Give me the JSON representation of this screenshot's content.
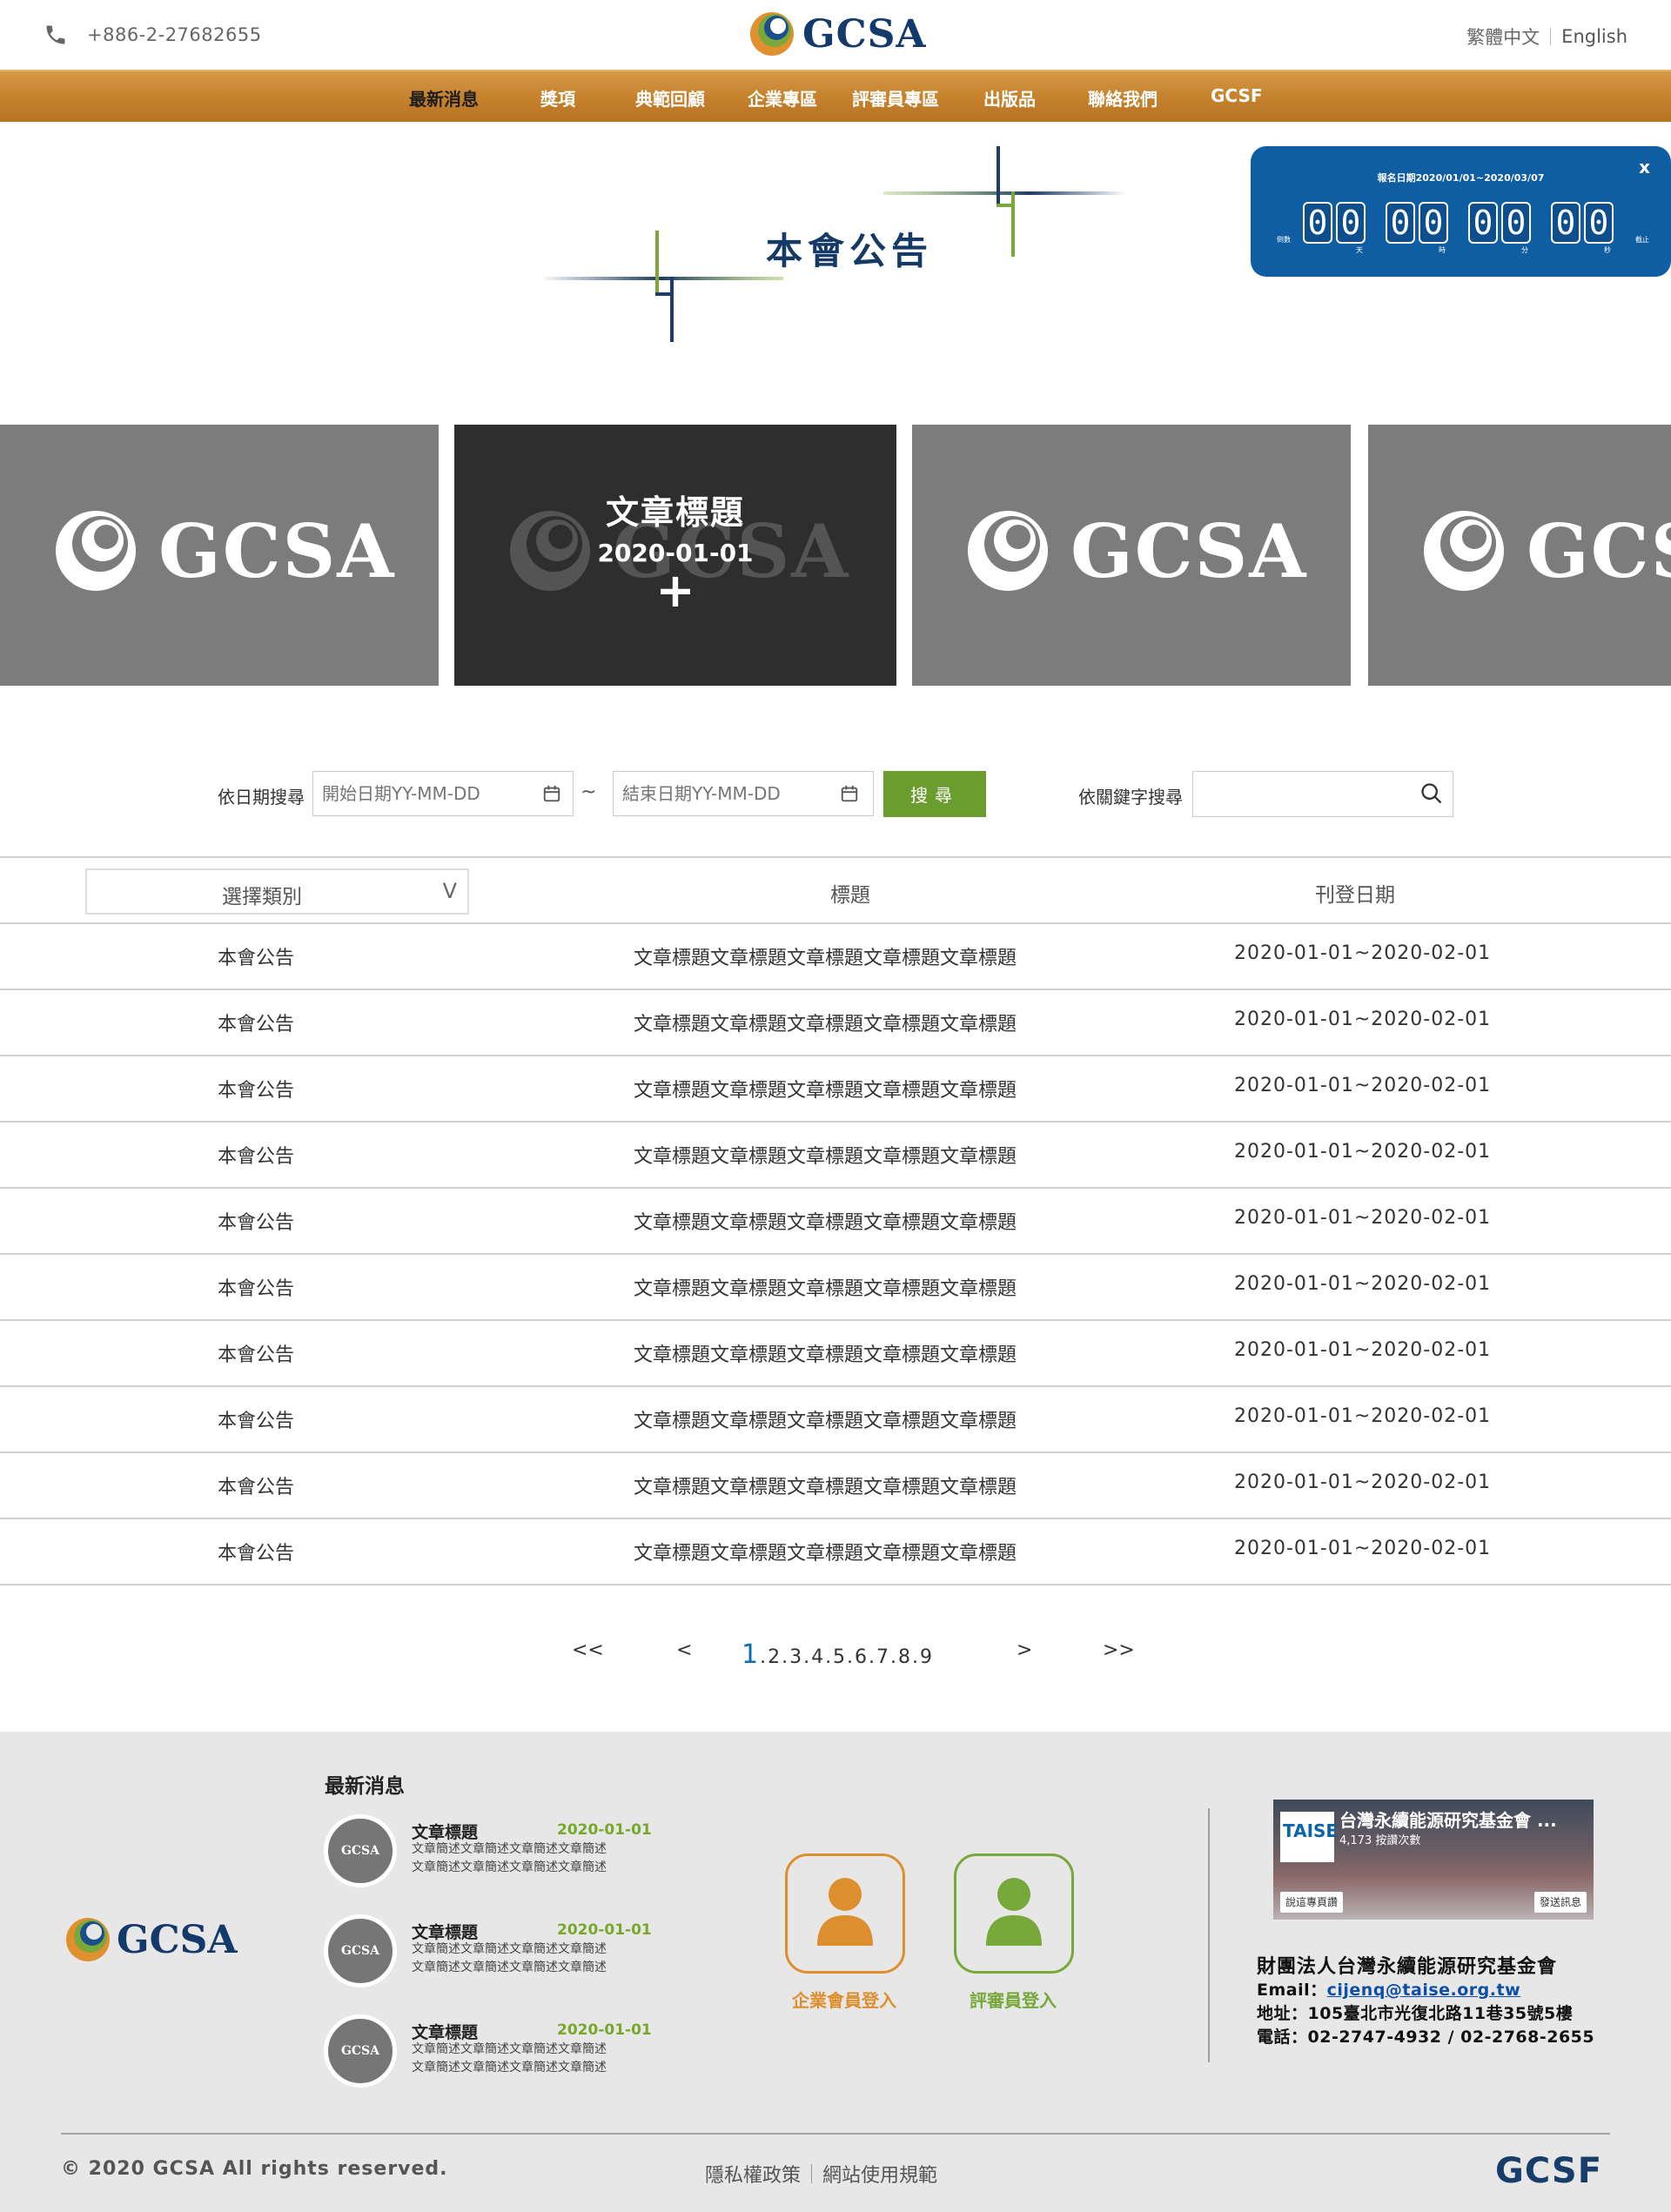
{
  "header": {
    "phone": "+886-2-27682655",
    "brand": "GCSA",
    "lang_zh": "繁體中文",
    "lang_en": "English"
  },
  "nav": {
    "items": [
      "最新消息",
      "獎項",
      "典範回顧",
      "企業專區",
      "評審員專區",
      "出版品",
      "聯絡我們",
      "GCSF"
    ]
  },
  "page_title": "本會公告",
  "countdown": {
    "close": "x",
    "period": "報名日期2020/01/01~2020/03/07",
    "left_label": "倒數",
    "right_label": "截止",
    "days": [
      "0",
      "0"
    ],
    "hours": [
      "0",
      "0"
    ],
    "minutes": [
      "0",
      "0"
    ],
    "seconds": [
      "0",
      "0"
    ],
    "units": [
      "天",
      "時",
      "分",
      "秒"
    ]
  },
  "cards": [
    {
      "logo": "GCSA"
    },
    {
      "logo": "GCSA",
      "title": "文章標題",
      "date": "2020-01-01",
      "plus": "+"
    },
    {
      "logo": "GCSA"
    },
    {
      "logo": "GCS"
    }
  ],
  "search": {
    "date_label": "依日期搜尋",
    "start_placeholder": "開始日期YY-MM-DD",
    "tilde": "~",
    "end_placeholder": "結束日期YY-MM-DD",
    "button": "搜尋",
    "keyword_label": "依關鍵字搜尋",
    "keyword_value": ""
  },
  "table": {
    "category_select": "選擇類別",
    "select_arrow": "V",
    "col_title": "標題",
    "col_date": "刊登日期",
    "rows": [
      {
        "category": "本會公告",
        "title": "文章標題文章標題文章標題文章標題文章標題",
        "date": "2020-01-01~2020-02-01"
      },
      {
        "category": "本會公告",
        "title": "文章標題文章標題文章標題文章標題文章標題",
        "date": "2020-01-01~2020-02-01"
      },
      {
        "category": "本會公告",
        "title": "文章標題文章標題文章標題文章標題文章標題",
        "date": "2020-01-01~2020-02-01"
      },
      {
        "category": "本會公告",
        "title": "文章標題文章標題文章標題文章標題文章標題",
        "date": "2020-01-01~2020-02-01"
      },
      {
        "category": "本會公告",
        "title": "文章標題文章標題文章標題文章標題文章標題",
        "date": "2020-01-01~2020-02-01"
      },
      {
        "category": "本會公告",
        "title": "文章標題文章標題文章標題文章標題文章標題",
        "date": "2020-01-01~2020-02-01"
      },
      {
        "category": "本會公告",
        "title": "文章標題文章標題文章標題文章標題文章標題",
        "date": "2020-01-01~2020-02-01"
      },
      {
        "category": "本會公告",
        "title": "文章標題文章標題文章標題文章標題文章標題",
        "date": "2020-01-01~2020-02-01"
      },
      {
        "category": "本會公告",
        "title": "文章標題文章標題文章標題文章標題文章標題",
        "date": "2020-01-01~2020-02-01"
      },
      {
        "category": "本會公告",
        "title": "文章標題文章標題文章標題文章標題文章標題",
        "date": "2020-01-01~2020-02-01"
      }
    ]
  },
  "pagination": {
    "first": "<<",
    "prev": "<",
    "current": "1",
    "pages": ".2.3.4.5.6.7.8.9",
    "next": ">",
    "last": ">>"
  },
  "footer": {
    "logo": "GCSA",
    "news_heading": "最新消息",
    "news": [
      {
        "avatar": "GCSA",
        "title": "文章標題",
        "date": "2020-01-01",
        "desc": [
          "文章簡述文章簡述文章簡述文章簡述",
          "文章簡述文章簡述文章簡述文章簡述"
        ]
      },
      {
        "avatar": "GCSA",
        "title": "文章標題",
        "date": "2020-01-01",
        "desc": [
          "文章簡述文章簡述文章簡述文章簡述",
          "文章簡述文章簡述文章簡述文章簡述"
        ]
      },
      {
        "avatar": "GCSA",
        "title": "文章標題",
        "date": "2020-01-01",
        "desc": [
          "文章簡述文章簡述文章簡述文章簡述",
          "文章簡述文章簡述文章簡述文章簡述"
        ]
      }
    ],
    "corp_login": "企業會員登入",
    "judge_login": "評審員登入",
    "fb": {
      "badge": "TAISE",
      "name": "台灣永續能源研究基金會 ...",
      "count": "4,173 按讚次數",
      "like": "說這專頁讚",
      "message": "發送訊息"
    },
    "org_name": "財團法人台灣永續能源研究基金會",
    "email_label": "Email：",
    "email": "cijenq@taise.org.tw",
    "address": "地址：105臺北市光復北路11巷35號5樓",
    "tel": "電話：02-2747-4932 / 02-2768-2655",
    "copyright": "© 2020 GCSA All rights reserved.",
    "privacy": "隱私權政策",
    "terms": "網站使用規範",
    "gcsf": "GCSF"
  },
  "colors": {
    "nav_orange": "#c4802b",
    "brand_navy": "#143a6b",
    "green": "#6a9c2e",
    "countdown_blue": "#0f5da2"
  }
}
